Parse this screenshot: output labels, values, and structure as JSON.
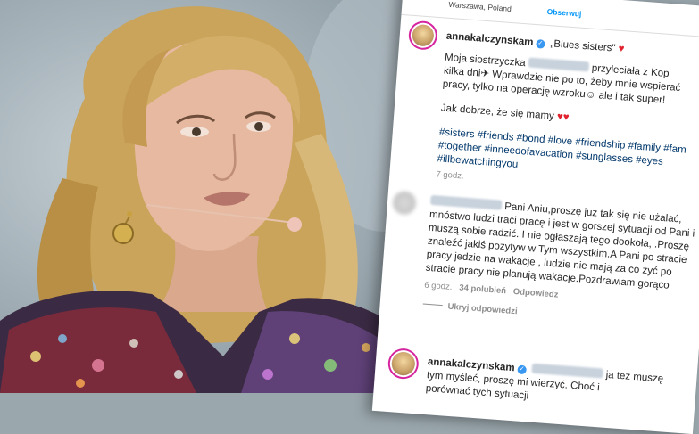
{
  "post": {
    "location": "Warszawa, Poland",
    "follow_label": "Obserwuj",
    "author": "annakalczynskam",
    "caption_title": "„Blues sisters\"",
    "caption_line1": "Moja siostrzyczka",
    "caption_line1b": "przyleciała z Kop",
    "caption_line2": "kilka dni",
    "caption_line2b": "Wprawdzie nie po to, żeby mnie wspierać",
    "caption_line3": "pracy, tylko na operację wzroku",
    "caption_line3b": "ale i tak super!",
    "caption_line4": "Jak dobrze, że się mamy",
    "hashtags": "#sisters #friends #bond #love #friendship #family #fam #together #inneedofavacation #sunglasses #eyes #illbewatchingyou",
    "time": "7 godz."
  },
  "comment": {
    "text": "Pani Aniu,proszę już tak się nie użalać, mnóstwo ludzi traci pracę i jest w gorszej sytuacji od Pani i muszą sobie radzić. I nie ogłaszają tego dookoła, .Proszę znaleźć jakiś pozytyw w Tym wszystkim.A Pani po stracie pracy jedzie na wakacje , ludzie nie mają za co żyć po stracie pracy nie planują wakacje.Pozdrawiam gorąco",
    "time": "6 godz.",
    "likes": "34 polubień",
    "reply_label": "Odpowiedz",
    "hide_replies": "Ukryj odpowiedzi"
  },
  "reply": {
    "author": "annakalczynskam",
    "text_a": "ja też muszę",
    "text_b": "tym myśleć, proszę mi wierzyć. Choć i",
    "text_c": "porównać tych sytuacji"
  }
}
